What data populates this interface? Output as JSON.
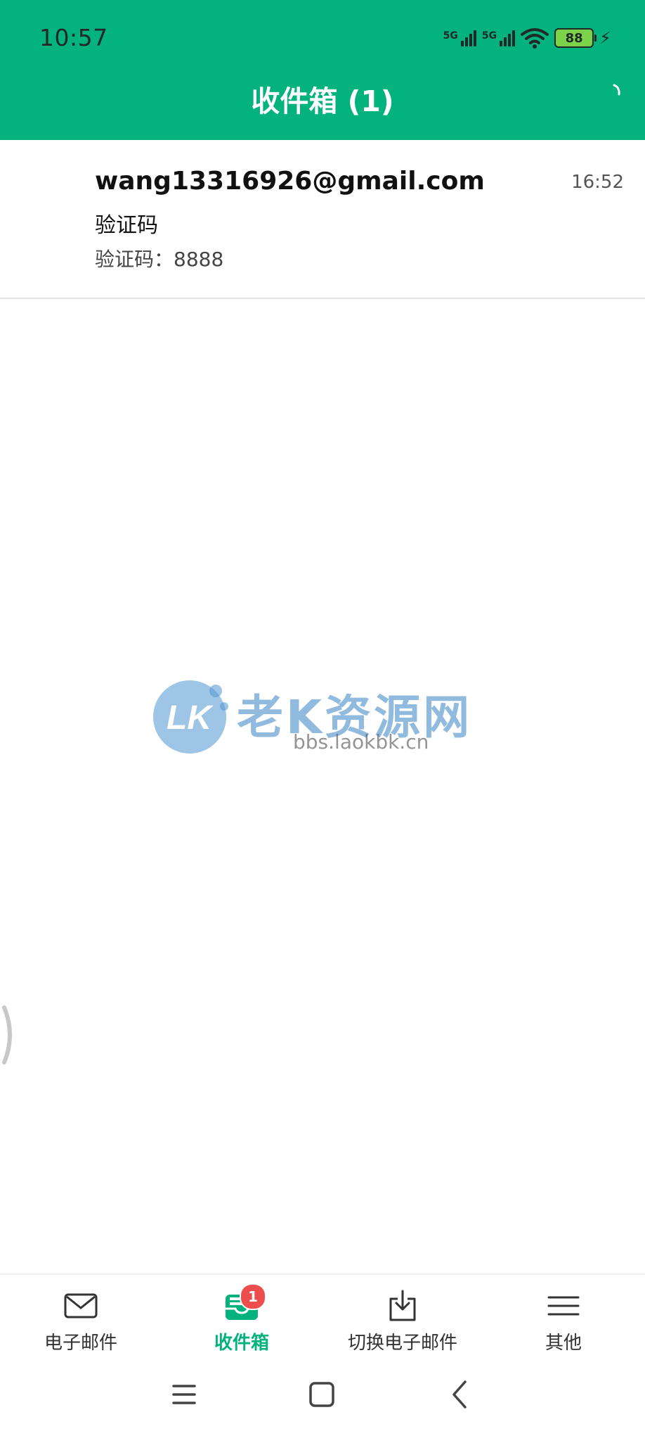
{
  "status_bar": {
    "time": "10:57",
    "signal_1_label": "5G",
    "signal_2_label": "5G",
    "battery_level": "88",
    "icons": [
      "5g-signal-icon",
      "5g-signal-icon",
      "wifi-icon",
      "battery-icon",
      "charging-bolt-icon"
    ]
  },
  "header": {
    "title": "收件箱 (1)",
    "action_icon": "refresh-icon",
    "background_color": "#03b27d"
  },
  "inbox": {
    "messages": [
      {
        "from": "wang13316926@gmail.com",
        "time": "16:52",
        "subject": "验证码",
        "preview": "验证码：8888"
      }
    ]
  },
  "watermark": {
    "text": "老K资源网",
    "url": "bbs.laokbk.cn",
    "logo_text": "LK"
  },
  "bottom_nav": {
    "active_color": "#03b27d",
    "items": [
      {
        "label": "电子邮件",
        "icon": "mail-icon"
      },
      {
        "label": "收件箱",
        "icon": "inbox-icon",
        "badge": "1",
        "active": true
      },
      {
        "label": "切换电子邮件",
        "icon": "download-tray-icon"
      },
      {
        "label": "其他",
        "icon": "menu-icon"
      }
    ]
  },
  "system_nav": {
    "icons": [
      "recent-apps-icon",
      "home-icon",
      "back-icon"
    ]
  }
}
